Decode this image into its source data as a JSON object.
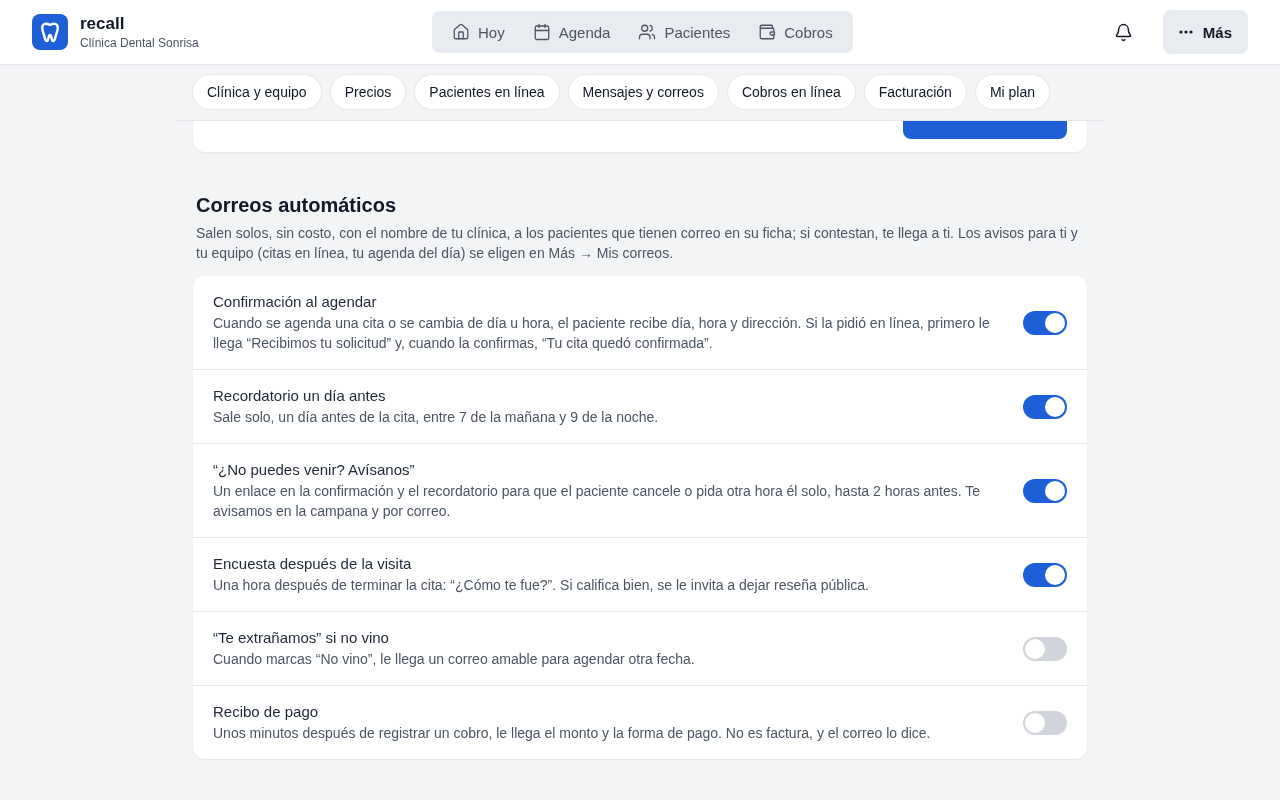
{
  "brand": {
    "name": "recall",
    "clinic": "Clínica Dental Sonrisa"
  },
  "nav": [
    {
      "label": "Hoy",
      "selected": false
    },
    {
      "label": "Agenda",
      "selected": false
    },
    {
      "label": "Pacientes",
      "selected": false
    },
    {
      "label": "Cobros",
      "selected": false
    }
  ],
  "more_button": "Más",
  "settings_tabs": [
    {
      "label": "Clínica y equipo",
      "selected": false
    },
    {
      "label": "Precios",
      "selected": false
    },
    {
      "label": "Pacientes en línea",
      "selected": false
    },
    {
      "label": "Mensajes y correos",
      "selected": false
    },
    {
      "label": "Cobros en línea",
      "selected": false
    },
    {
      "label": "Facturación",
      "selected": false
    },
    {
      "label": "Mi plan",
      "selected": false
    }
  ],
  "section": {
    "title": "Correos automáticos",
    "description": "Salen solos, sin costo, con el nombre de tu clínica, a los pacientes que tienen correo en su ficha; si contestan, te llega a ti. Los avisos para ti y tu equipo (citas en línea, tu agenda del día) se eligen en Más → Mis correos.",
    "items": [
      {
        "title": "Confirmación al agendar",
        "description": "Cuando se agenda una cita o se cambia de día u hora, el paciente recibe día, hora y dirección. Si la pidió en línea, primero le llega “Recibimos tu solicitud” y, cuando la confirmas, “Tu cita quedó confirmada”.",
        "on": true
      },
      {
        "title": "Recordatorio un día antes",
        "description": "Sale solo, un día antes de la cita, entre 7 de la mañana y 9 de la noche.",
        "on": true
      },
      {
        "title": "“¿No puedes venir? Avísanos”",
        "description": "Un enlace en la confirmación y el recordatorio para que el paciente cancele o pida otra hora él solo, hasta 2 horas antes. Te avisamos en la campana y por correo.",
        "on": true
      },
      {
        "title": "Encuesta después de la visita",
        "description": "Una hora después de terminar la cita: “¿Cómo te fue?”. Si califica bien, se le invita a dejar reseña pública.",
        "on": true
      },
      {
        "title": "“Te extrañamos” si no vino",
        "description": "Cuando marcas “No vino”, le llega un correo amable para agendar otra fecha.",
        "on": false
      },
      {
        "title": "Recibo de pago",
        "description": "Unos minutos después de registrar un cobro, le llega el monto y la forma de pago. No es factura, y el correo lo dice.",
        "on": false
      }
    ]
  }
}
